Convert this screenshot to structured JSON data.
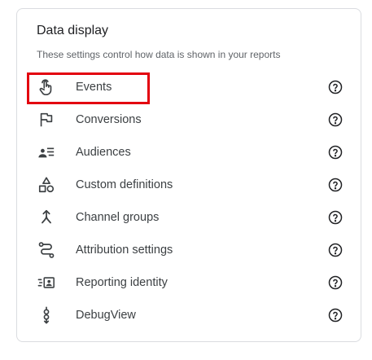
{
  "panel": {
    "title": "Data display",
    "description": "These settings control how data is shown in your reports"
  },
  "items": [
    {
      "label": "Events",
      "icon": "touch-hand-icon",
      "help_icon": "help-circle-icon"
    },
    {
      "label": "Conversions",
      "icon": "flag-icon",
      "help_icon": "help-circle-icon"
    },
    {
      "label": "Audiences",
      "icon": "person-list-icon",
      "help_icon": "help-circle-icon"
    },
    {
      "label": "Custom definitions",
      "icon": "shapes-icon",
      "help_icon": "help-circle-icon"
    },
    {
      "label": "Channel groups",
      "icon": "merge-arrow-icon",
      "help_icon": "help-circle-icon"
    },
    {
      "label": "Attribution settings",
      "icon": "route-path-icon",
      "help_icon": "help-circle-icon"
    },
    {
      "label": "Reporting identity",
      "icon": "id-card-lines-icon",
      "help_icon": "help-circle-icon"
    },
    {
      "label": "DebugView",
      "icon": "debug-nodes-icon",
      "help_icon": "help-circle-icon"
    }
  ],
  "highlight": {
    "target": "Events",
    "color": "#e3000f"
  },
  "colors": {
    "icon": "#3c4043",
    "border": "#dadce0",
    "text": "#3c4043"
  }
}
